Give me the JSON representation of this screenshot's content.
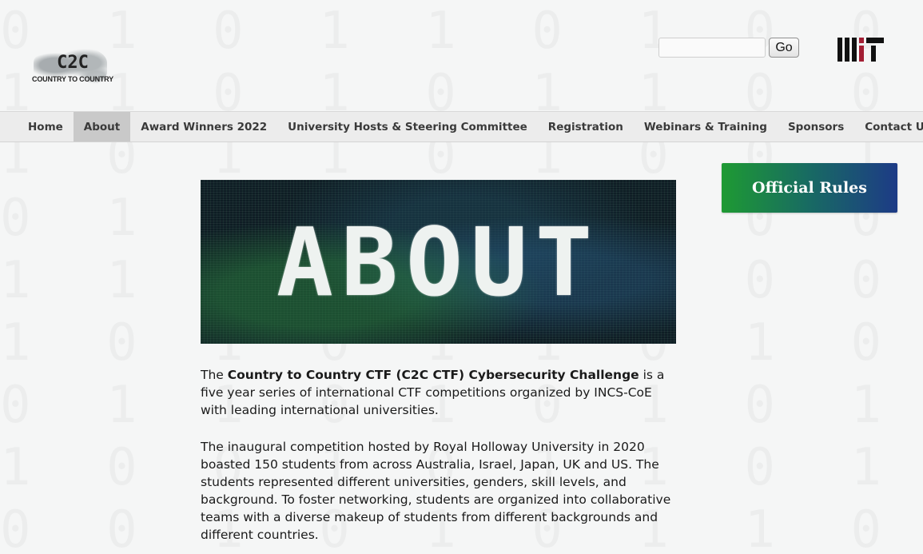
{
  "header": {
    "logo_mark": "C2C",
    "logo_subtitle": "COUNTRY TO COUNTRY",
    "search": {
      "value": "",
      "placeholder": ""
    },
    "go_label": "Go",
    "mit_logo_text": "MIT"
  },
  "nav": {
    "items": [
      {
        "label": "Home",
        "active": false
      },
      {
        "label": "About",
        "active": true
      },
      {
        "label": "Award Winners 2022",
        "active": false
      },
      {
        "label": "University Hosts & Steering Committee",
        "active": false
      },
      {
        "label": "Registration",
        "active": false
      },
      {
        "label": "Webinars & Training",
        "active": false
      },
      {
        "label": "Sponsors",
        "active": false
      },
      {
        "label": "Contact Us",
        "active": false
      }
    ]
  },
  "hero": {
    "title": "ABOUT"
  },
  "sidebar": {
    "official_rules_label": "Official Rules"
  },
  "content": {
    "p1_prefix": "The ",
    "p1_bold": "Country to Country CTF (C2C CTF) Cybersecurity Challenge",
    "p1_suffix": " is a five year series of international CTF competitions organized by INCS-CoE with leading international universities.",
    "p2": "The inaugural competition hosted by Royal Holloway University in 2020 boasted 150 students from across Australia, Israel, Japan, UK and US. The students represented different universities, genders, skill levels, and background. To foster networking, students are organized into collaborative teams with a diverse makeup of students from different backgrounds and different countries."
  },
  "colors": {
    "nav_active_bg": "#c9c9c9",
    "rules_gradient_start": "#1e9a33",
    "rules_gradient_end": "#1d3b86",
    "mit_red": "#a31f34"
  }
}
